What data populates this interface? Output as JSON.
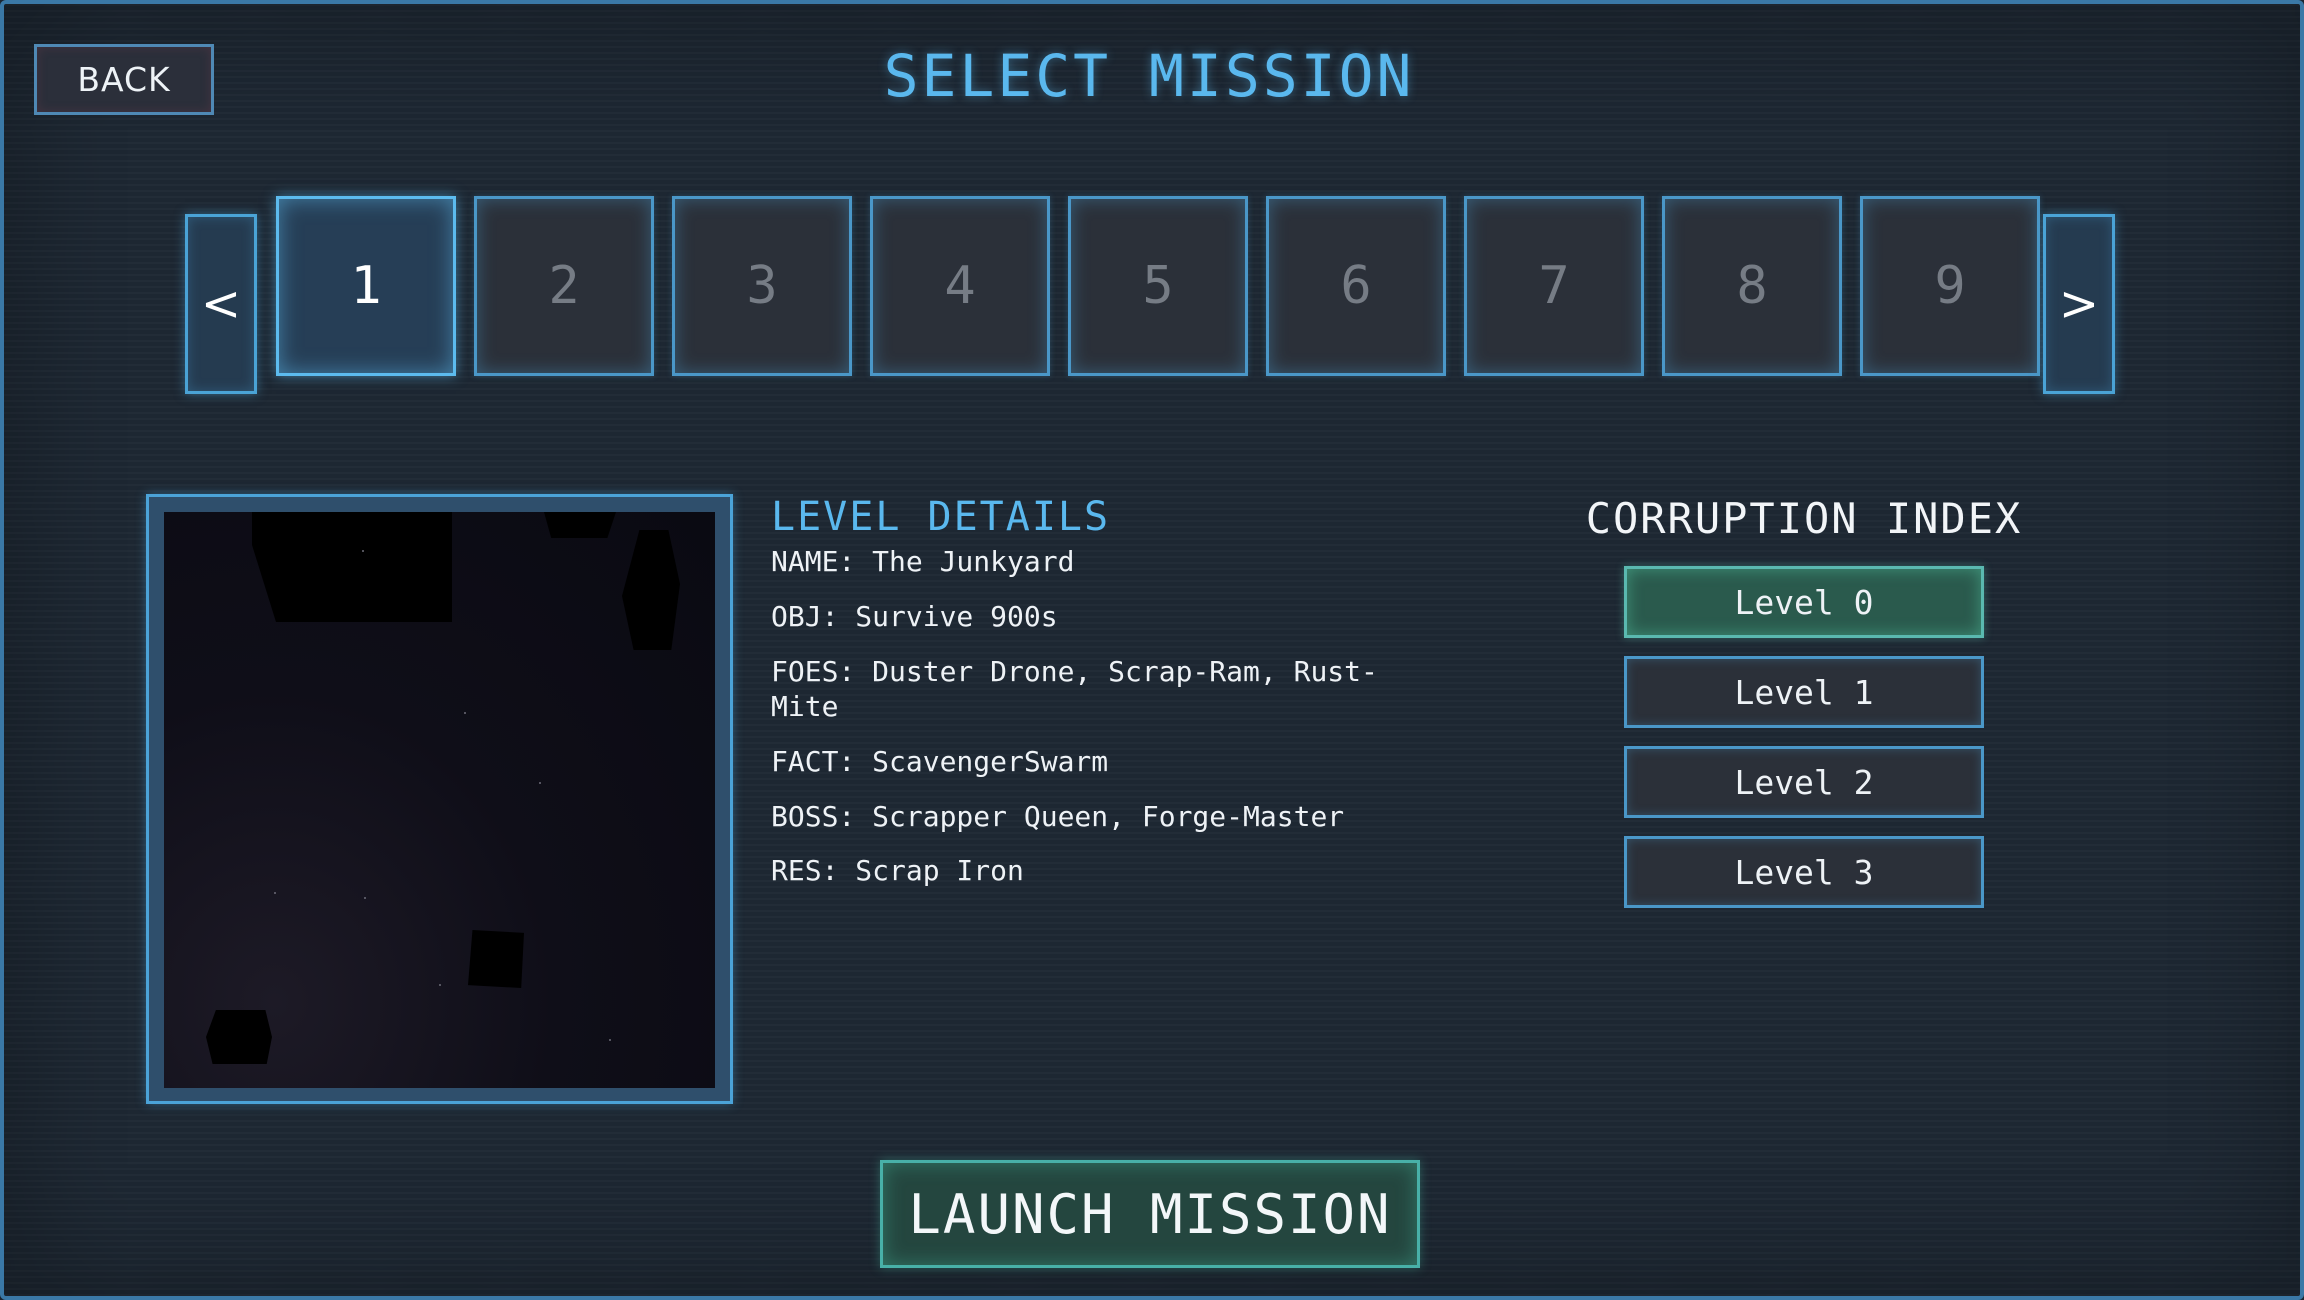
{
  "header": {
    "back_label": "BACK",
    "title": "SELECT MISSION"
  },
  "mission_selector": {
    "prev_label": "<",
    "next_label": ">",
    "selected": "1",
    "missions": [
      "1",
      "2",
      "3",
      "4",
      "5",
      "6",
      "7",
      "8",
      "9"
    ]
  },
  "preview": {
    "icon": "level-preview-image"
  },
  "details": {
    "heading": "LEVEL DETAILS",
    "name": "NAME: The Junkyard",
    "obj": "OBJ: Survive 900s",
    "foes": "FOES: Duster Drone, Scrap-Ram, Rust-Mite",
    "fact": "FACT: ScavengerSwarm",
    "boss": "BOSS: Scrapper Queen, Forge-Master",
    "res": "RES: Scrap Iron"
  },
  "corruption": {
    "heading": "CORRUPTION INDEX",
    "selected": "Level 0",
    "levels": [
      "Level 0",
      "Level 1",
      "Level 2",
      "Level 3"
    ]
  },
  "launch_label": "LAUNCH MISSION",
  "colors": {
    "accent_blue": "#5ab8ee",
    "frame_blue": "#4a97c8",
    "selected_green": "#2a5a4d",
    "panel_dark": "#1d2732"
  }
}
